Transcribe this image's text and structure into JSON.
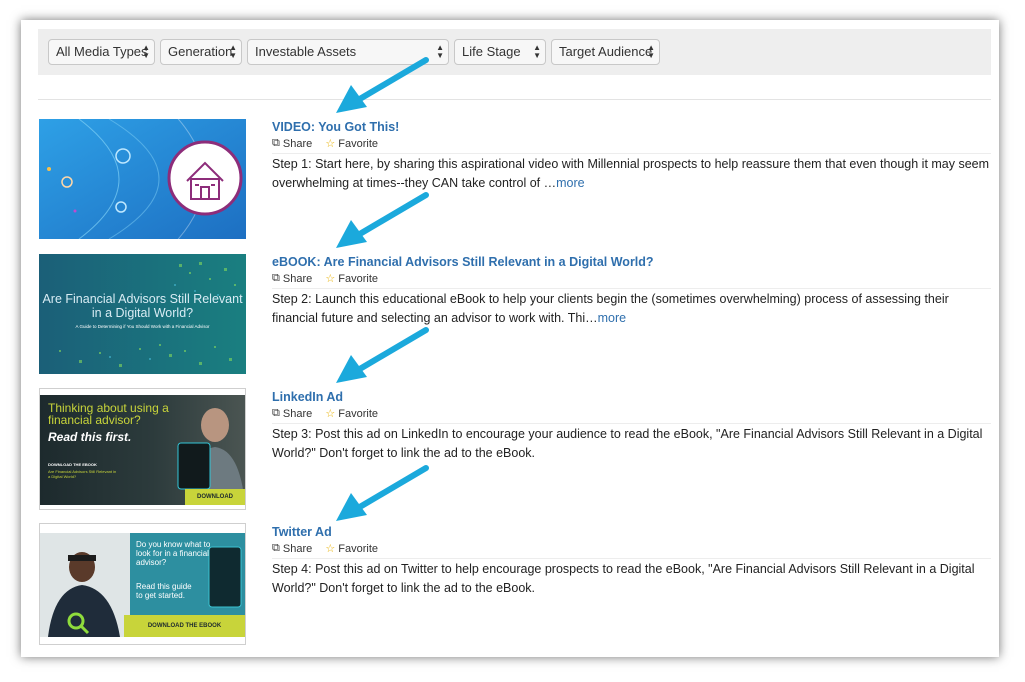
{
  "filters": [
    {
      "label": "All Media Types"
    },
    {
      "label": "Generation"
    },
    {
      "label": "Investable Assets"
    },
    {
      "label": "Life Stage"
    },
    {
      "label": "Target Audience"
    }
  ],
  "actions": {
    "share": "Share",
    "favorite": "Favorite"
  },
  "items": [
    {
      "title": "VIDEO: You Got This!",
      "description": "Step 1: Start here, by sharing this aspirational video with Millennial prospects to help reassure them that even though it may seem overwhelming at times--they CAN take control of …",
      "more": "more"
    },
    {
      "title": "eBOOK: Are Financial Advisors Still Relevant in a Digital World?",
      "description": "Step 2: Launch this educational eBook to help your clients begin the (sometimes overwhelming) process of assessing their financial future and selecting an advisor to work with. Thi…",
      "more": "more",
      "thumb_title": "Are Financial Advisors Still Relevant in a Digital World?",
      "thumb_subtitle": "A Guide to Determining if You Should Work with a Financial Advisor"
    },
    {
      "title": "LinkedIn Ad",
      "description": "Step 3: Post this ad on LinkedIn to encourage your audience to read the eBook, \"Are Financial Advisors Still Relevant in a Digital World?\" Don't forget to link the ad to the eBook.",
      "thumb_headline": "Thinking about using a financial advisor?",
      "thumb_cta": "Read this first.",
      "thumb_small": "DOWNLOAD THE EBOOK",
      "thumb_small2": "Are Financial Advisors Still Relevant in a Digital World?",
      "thumb_button": "DOWNLOAD"
    },
    {
      "title": "Twitter Ad",
      "description": "Step 4: Post this ad on Twitter to help encourage prospects to read the eBook, \"Are Financial Advisors Still Relevant in a Digital World?\" Don't forget to link the ad to the eBook.",
      "thumb_text1": "Do you know what to look for in a financial advisor?",
      "thumb_text2": "Read this guide to get started.",
      "thumb_button": "DOWNLOAD THE EBOOK"
    }
  ],
  "colors": {
    "link": "#2f6fad",
    "arrow": "#1ba9dc",
    "star": "#e8b000"
  }
}
